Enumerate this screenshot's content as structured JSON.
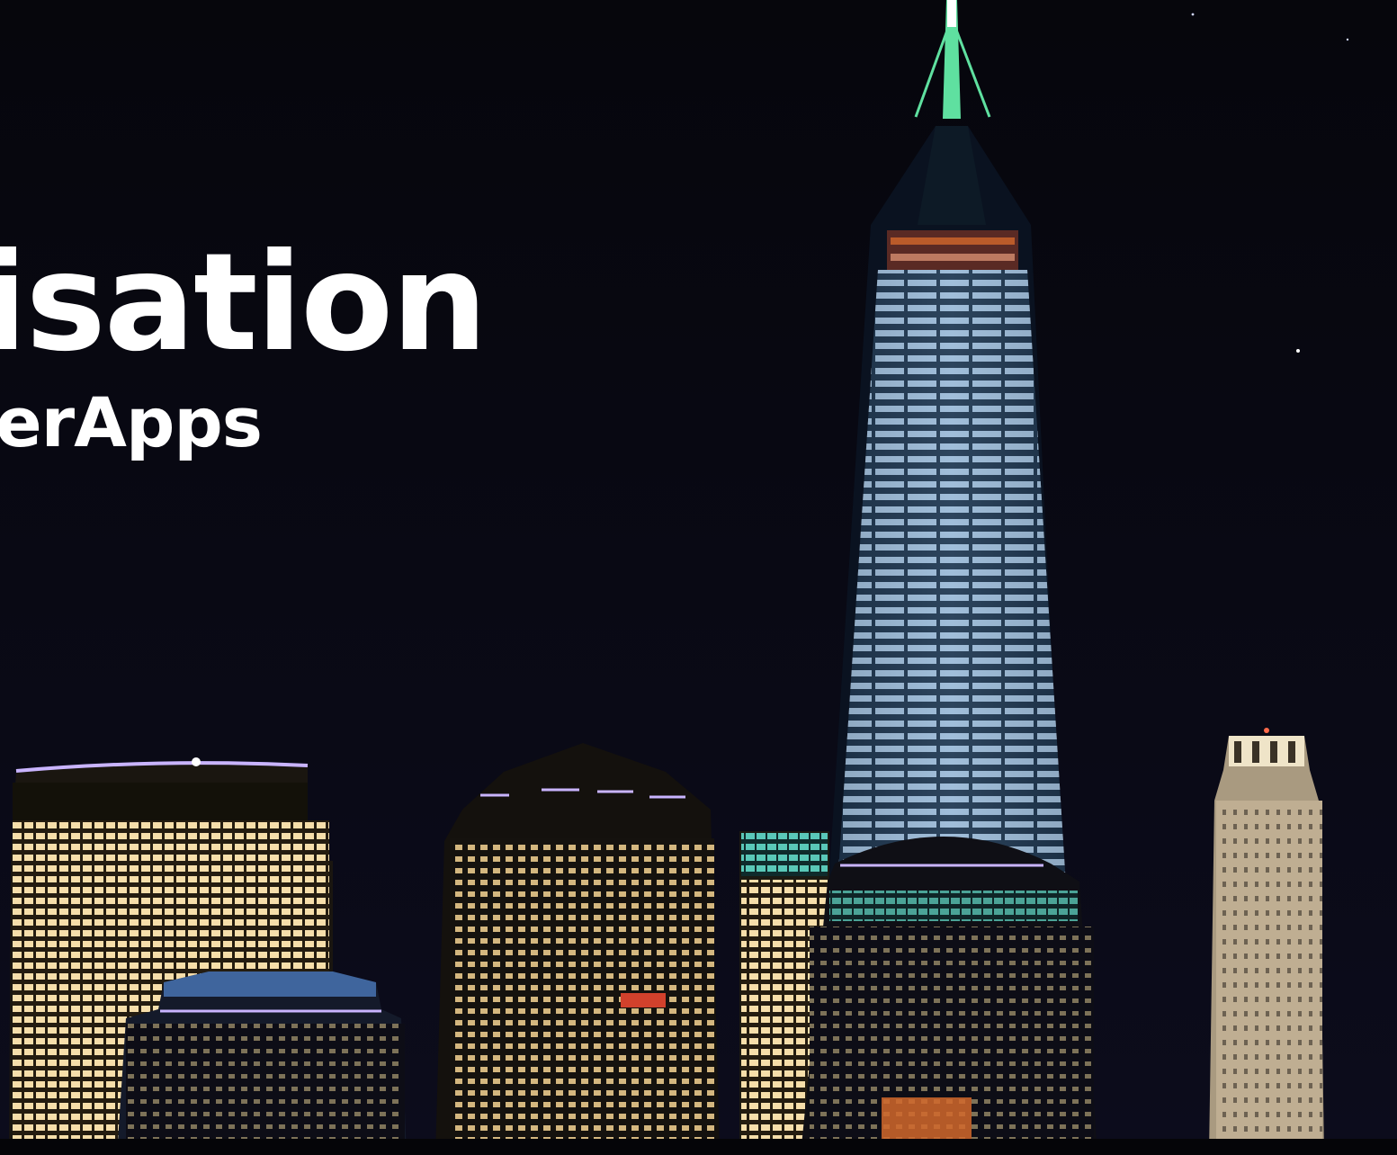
{
  "hero": {
    "headline": "misation",
    "subline": "verApps"
  },
  "colors": {
    "sky": "#07070f",
    "text": "#ffffff",
    "window_warm": "#f6deaa",
    "window_cool": "#c4dcf2",
    "accent_green": "#5fe0a0",
    "accent_violet": "#c9b4ff",
    "accent_teal": "#5ac8b8",
    "accent_orange": "#d2682c"
  }
}
